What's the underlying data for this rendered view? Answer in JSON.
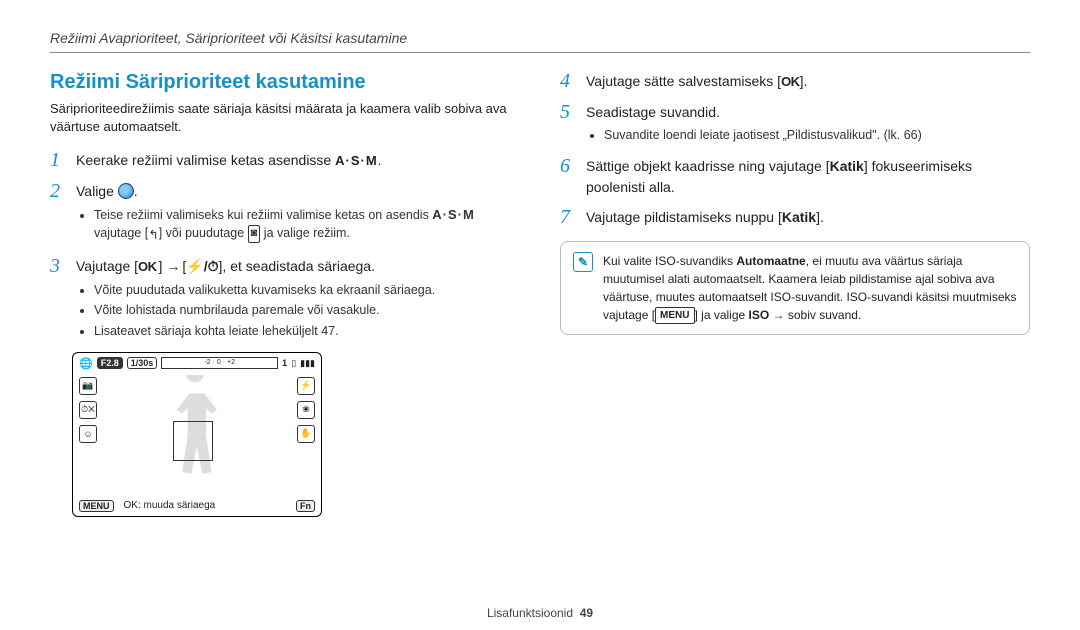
{
  "running_head": "Režiimi Avaprioriteet, Säriprioriteet või Käsitsi kasutamine",
  "section_title": "Režiimi Säriprioriteet kasutamine",
  "intro": "Säriprioriteedirežiimis saate säriaja käsitsi määrata ja kaamera valib sobiva ava väärtuse automaatselt.",
  "steps_left": {
    "s1": "Keerake režiimi valimise ketas asendisse ",
    "s1_icon": "A·S·M",
    "s1_end": ".",
    "s2": "Valige ",
    "s2_end": ".",
    "s2_sub1a": "Teise režiimi valimiseks kui režiimi valimise ketas on asendis ",
    "s2_sub1b": " vajutage [",
    "s2_sub1_icon": "↰",
    "s2_sub1c": "] või puudutage ",
    "s2_sub1d": " ja valige režiim.",
    "s3a": "Vajutage [",
    "s3_ok": "OK",
    "s3b": "] → [",
    "s3_ft": "⚡/⏱",
    "s3c": "], et seadistada säriaega.",
    "s3_sub1": "Võite puudutada valikuketta kuvamiseks ka ekraanil säriaega.",
    "s3_sub2": "Võite lohistada numbrilauda paremale või vasakule.",
    "s3_sub3": "Lisateavet säriaja kohta leiate leheküljelt 47."
  },
  "steps_right": {
    "s4a": "Vajutage sätte salvestamiseks [",
    "s4_ok": "OK",
    "s4b": "].",
    "s5": "Seadistage suvandid.",
    "s5_sub1": "Suvandite loendi leiate jaotisest „Pildistusvalikud\". (lk. 66)",
    "s6a": "Sättige objekt kaadrisse ning vajutage [",
    "s6_k": "Katik",
    "s6b": "] fokuseerimiseks poolenisti alla.",
    "s7a": "Vajutage pildistamiseks nuppu [",
    "s7_k": "Katik",
    "s7b": "]."
  },
  "note": {
    "a": "Kui valite ISO-suvandiks ",
    "auto": "Automaatne",
    "b": ", ei muutu ava väärtus säriaja muutumisel alati automaatselt. Kaamera leiab pildistamise ajal sobiva ava väärtuse, muutes automaatselt ISO-suvandit. ISO-suvandi käsitsi muutmiseks vajutage [",
    "menu": "MENU",
    "c": "] ja valige ",
    "iso": "ISO",
    "d": " → sobiv suvand."
  },
  "lcd": {
    "globe": "🌐",
    "f": "F2.8",
    "shutter": "1/30s",
    "ev": "±0",
    "count": "1",
    "shots": "📷",
    "batt": "▮▮▮",
    "menu": "MENU",
    "ok_label": "OK: muuda säriaega",
    "fn": "Fn"
  },
  "footer": {
    "chapter": "Lisafunktsioonid",
    "page": "49"
  }
}
